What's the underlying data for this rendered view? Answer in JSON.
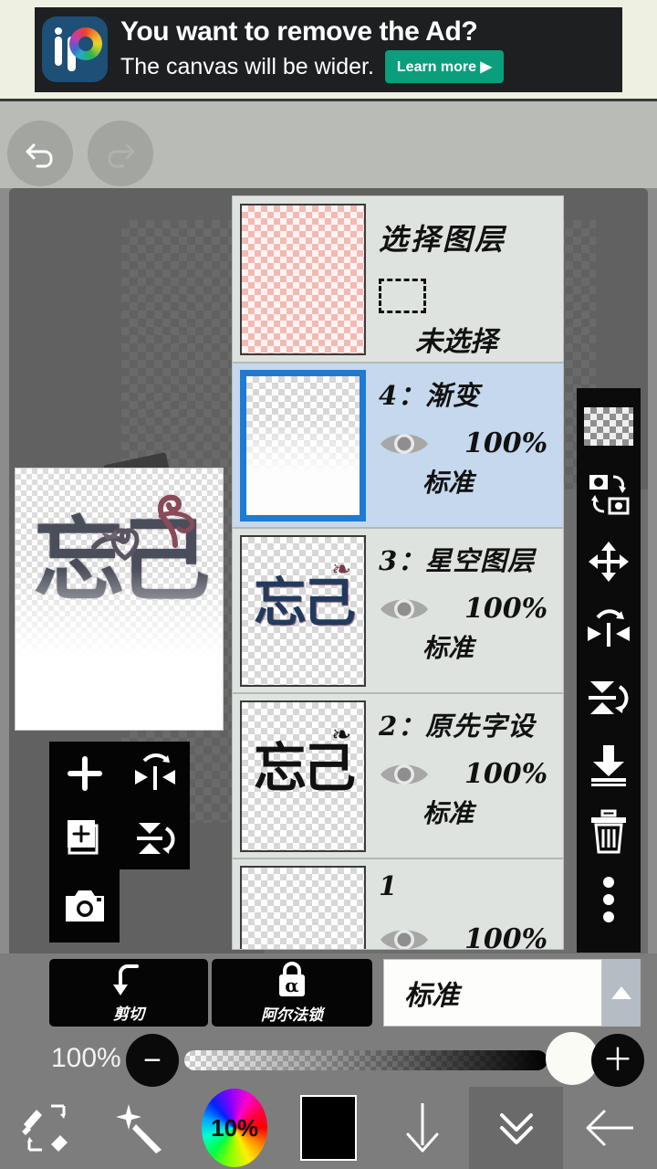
{
  "ad": {
    "headline": "You want to remove the Ad?",
    "subtext": "The canvas will be wider.",
    "cta_label": "Learn more ▶",
    "logo_name": "ibispaint-logo",
    "bg_color": "#1d1f21",
    "cta_color": "#0a9e7c",
    "banner_bg": "#eef0e2"
  },
  "topnav": {
    "undo_label": "undo",
    "redo_label": "redo"
  },
  "artwork": {
    "glyph": "忘己",
    "swirl": "❧",
    "heart": "❥"
  },
  "layer_panel": {
    "header": {
      "title": "选择图层",
      "status": "未选择",
      "marquee_icon": "dashed-rectangle-icon"
    },
    "layers": [
      {
        "name": "4：渐变",
        "opacity": "100%",
        "blend": "标准",
        "selected": true,
        "thumb": "gradient",
        "glyph": ""
      },
      {
        "name": "3：星空图层",
        "opacity": "100%",
        "blend": "标准",
        "selected": false,
        "thumb": "galaxy",
        "glyph": "忘己"
      },
      {
        "name": "2：原先字设",
        "opacity": "100%",
        "blend": "标准",
        "selected": false,
        "thumb": "ink",
        "glyph": "忘己"
      },
      {
        "name": "1",
        "opacity": "100%",
        "blend": "",
        "selected": false,
        "thumb": "empty",
        "glyph": ""
      }
    ],
    "selected_border_color": "#1f7ad4",
    "selected_row_color": "#c5d8ed",
    "row_color": "#dfe3df"
  },
  "right_toolbar": {
    "items": [
      {
        "name": "transparency-swatch",
        "label": "transparency"
      },
      {
        "name": "swap-layers-icon",
        "label": "swap layers"
      },
      {
        "name": "move-icon",
        "label": "move"
      },
      {
        "name": "flip-horizontal-icon",
        "label": "flip horizontal"
      },
      {
        "name": "flip-vertical-icon",
        "label": "flip vertical"
      },
      {
        "name": "merge-down-icon",
        "label": "merge down"
      },
      {
        "name": "delete-icon",
        "label": "delete layer"
      },
      {
        "name": "more-options-icon",
        "label": "more"
      }
    ]
  },
  "left_tools": {
    "items": [
      {
        "name": "add-layer-icon",
        "label": "add layer"
      },
      {
        "name": "flip-horizontal-icon",
        "label": "flip horizontal"
      },
      {
        "name": "duplicate-layer-icon",
        "label": "duplicate layer"
      },
      {
        "name": "flip-vertical-icon",
        "label": "flip vertical"
      },
      {
        "name": "camera-icon",
        "label": "import photo"
      }
    ]
  },
  "layer_controls": {
    "clip_label": "剪切",
    "alpha_lock_label": "阿尔法锁",
    "alpha_lock_glyph": "α",
    "blend_mode_value": "标准",
    "opacity_value": "100%",
    "minus_label": "−",
    "plus_label": "＋",
    "dropdown_arrow": "▲"
  },
  "bottom_toolbar": {
    "items": [
      {
        "name": "brush-eraser-toggle-icon",
        "label": "brush / eraser"
      },
      {
        "name": "magic-wand-icon",
        "label": "tools"
      },
      {
        "name": "color-wheel-button",
        "label": "10%"
      },
      {
        "name": "color-swatch",
        "label": "black"
      },
      {
        "name": "down-arrow-icon",
        "label": "download"
      },
      {
        "name": "collapse-icon",
        "label": "collapse panel"
      },
      {
        "name": "back-arrow-icon",
        "label": "back"
      }
    ],
    "color_wheel_label": "10%",
    "active_index": 5
  }
}
